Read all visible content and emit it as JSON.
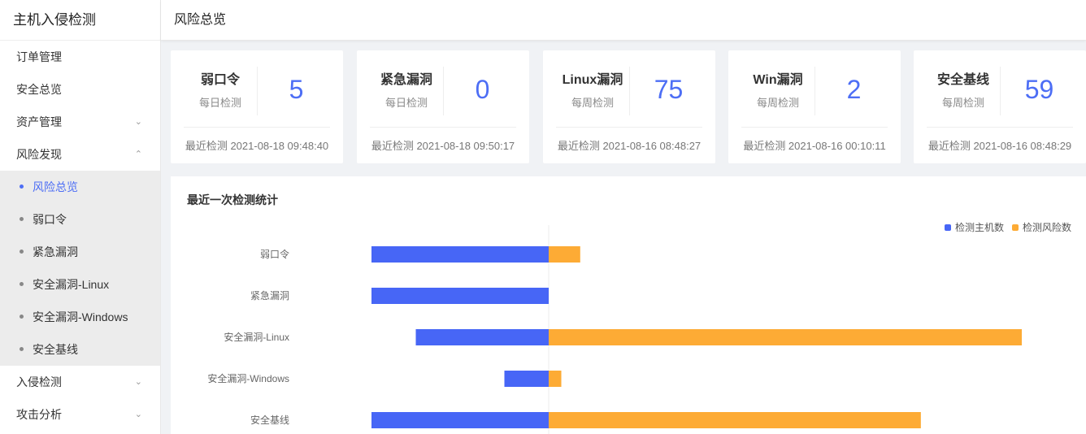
{
  "app": {
    "title": "主机入侵检测"
  },
  "header": {
    "title": "风险总览"
  },
  "sidebar": {
    "items": [
      {
        "label": "订单管理"
      },
      {
        "label": "安全总览"
      },
      {
        "label": "资产管理",
        "expandable": true,
        "expanded": false
      },
      {
        "label": "风险发现",
        "expandable": true,
        "expanded": true,
        "children": [
          {
            "label": "风险总览",
            "active": true
          },
          {
            "label": "弱口令"
          },
          {
            "label": "紧急漏洞"
          },
          {
            "label": "安全漏洞-Linux"
          },
          {
            "label": "安全漏洞-Windows"
          },
          {
            "label": "安全基线"
          }
        ]
      },
      {
        "label": "入侵检测",
        "expandable": true,
        "expanded": false
      },
      {
        "label": "攻击分析",
        "expandable": true,
        "expanded": false
      }
    ]
  },
  "cards": [
    {
      "name": "弱口令",
      "frequency": "每日检测",
      "value": "5",
      "last_check": "最近检测 2021-08-18 09:48:40"
    },
    {
      "name": "紧急漏洞",
      "frequency": "每日检测",
      "value": "0",
      "last_check": "最近检测 2021-08-18 09:50:17"
    },
    {
      "name": "Linux漏洞",
      "frequency": "每周检测",
      "value": "75",
      "last_check": "最近检测 2021-08-16 08:48:27"
    },
    {
      "name": "Win漏洞",
      "frequency": "每周检测",
      "value": "2",
      "last_check": "最近检测 2021-08-16 00:10:11"
    },
    {
      "name": "安全基线",
      "frequency": "每周检测",
      "value": "59",
      "last_check": "最近检测 2021-08-16 08:48:29"
    }
  ],
  "panel": {
    "title": "最近一次检测统计"
  },
  "colors": {
    "accent": "#4d6ef5",
    "hosts": "#4766f6",
    "risks": "#fdab35"
  },
  "chart_data": {
    "type": "bar",
    "orientation": "horizontal",
    "categories": [
      "弱口令",
      "紧急漏洞",
      "安全漏洞-Linux",
      "安全漏洞-Windows",
      "安全基线"
    ],
    "series": [
      {
        "name": "检测主机数",
        "values": [
          4,
          4,
          3,
          1,
          4
        ]
      },
      {
        "name": "检测风险数",
        "values": [
          5,
          0,
          75,
          2,
          59
        ]
      }
    ],
    "legend_position": "top-right",
    "grid": false
  }
}
